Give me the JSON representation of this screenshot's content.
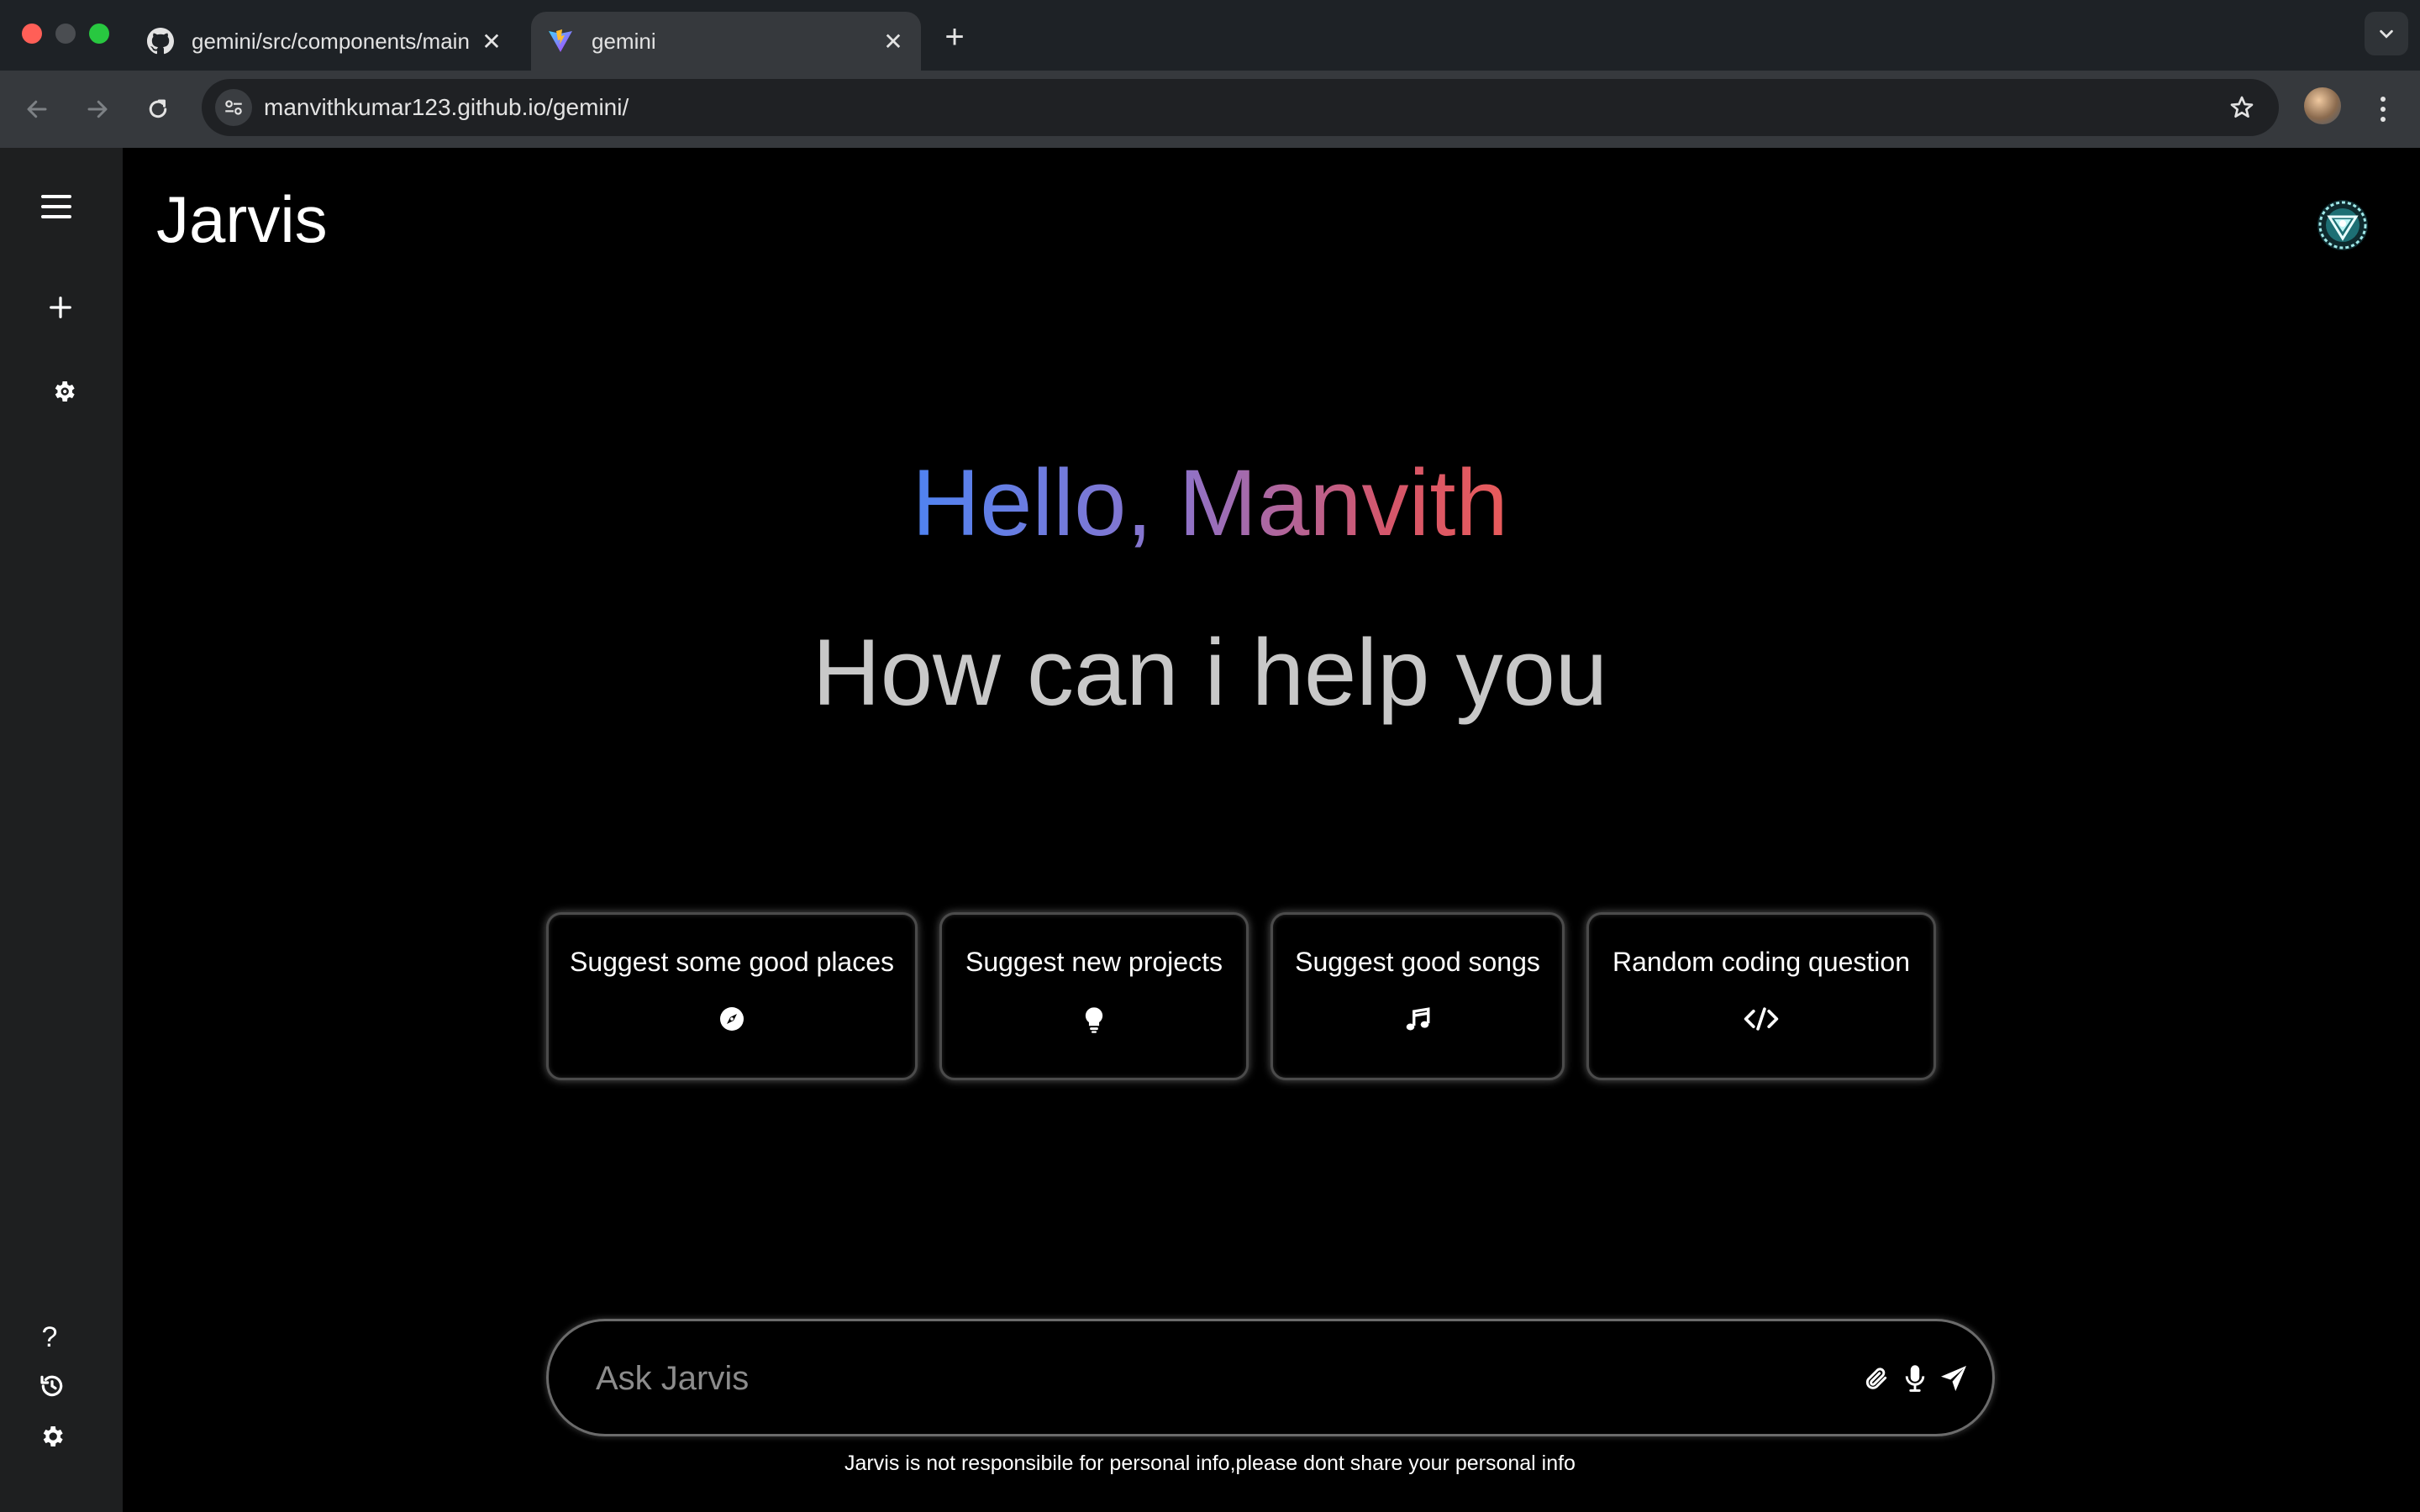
{
  "browser": {
    "tabs": [
      {
        "title": "gemini/src/components/main",
        "icon": "github-icon"
      },
      {
        "title": "gemini",
        "icon": "vite-icon"
      }
    ],
    "url": "manvithkumar123.github.io/gemini/"
  },
  "app": {
    "brand": "Jarvis",
    "greeting": "Hello, Manvith",
    "subtitle": "How can i help you",
    "cards": [
      {
        "label": "Suggest some good places",
        "icon": "compass-icon"
      },
      {
        "label": "Suggest new projects",
        "icon": "lightbulb-icon"
      },
      {
        "label": "Suggest good songs",
        "icon": "music-icon"
      },
      {
        "label": "Random coding question",
        "icon": "code-icon"
      }
    ],
    "input": {
      "placeholder": "Ask Jarvis",
      "value": ""
    },
    "disclaimer": "Jarvis is not responsibile for personal info,please dont share your personal info",
    "colors": {
      "gradient_start": "#4f83f2",
      "gradient_end": "#e85b5b",
      "background": "#000000",
      "sidebar": "#1e1f20"
    }
  }
}
